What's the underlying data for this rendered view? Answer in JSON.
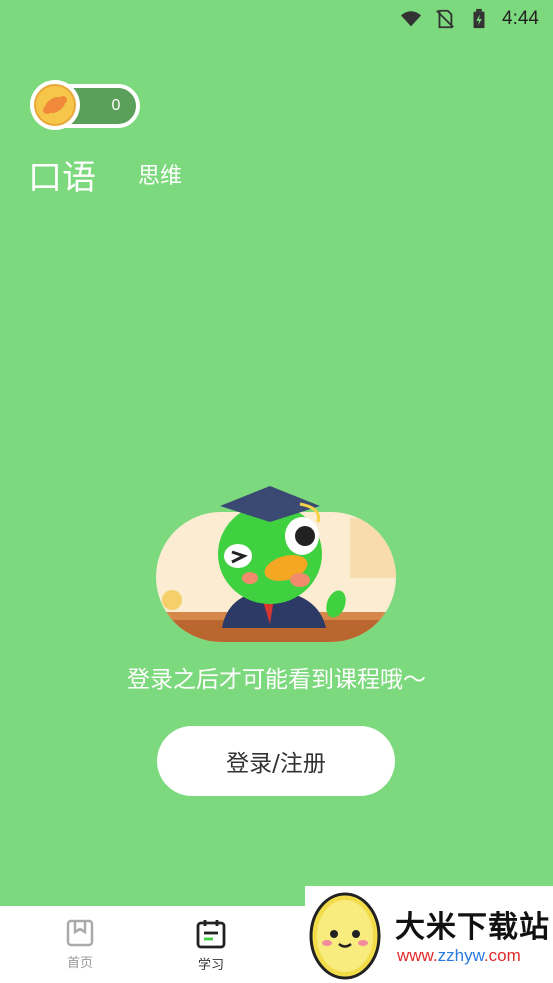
{
  "status_bar": {
    "time": "4:44",
    "icons": [
      "wifi-icon",
      "no-sim-icon",
      "battery-icon"
    ]
  },
  "coins": {
    "count": "0"
  },
  "tabs": {
    "active": "口语",
    "other": "思维"
  },
  "empty_state": {
    "message": "登录之后才可能看到课程哦～",
    "button_label": "登录/注册"
  },
  "bottom_nav": {
    "items": [
      {
        "label": "首页",
        "icon": "home-icon"
      },
      {
        "label": "学习",
        "icon": "calendar-icon"
      }
    ]
  },
  "watermark": {
    "title": "大米下载站",
    "url_prefix": "www.",
    "url_domain": "zzhyw",
    "url_suffix": ".com"
  },
  "colors": {
    "background": "#7dd97d",
    "coin_pill": "#5a9f5a",
    "coin_gold": "#f5c64a"
  }
}
